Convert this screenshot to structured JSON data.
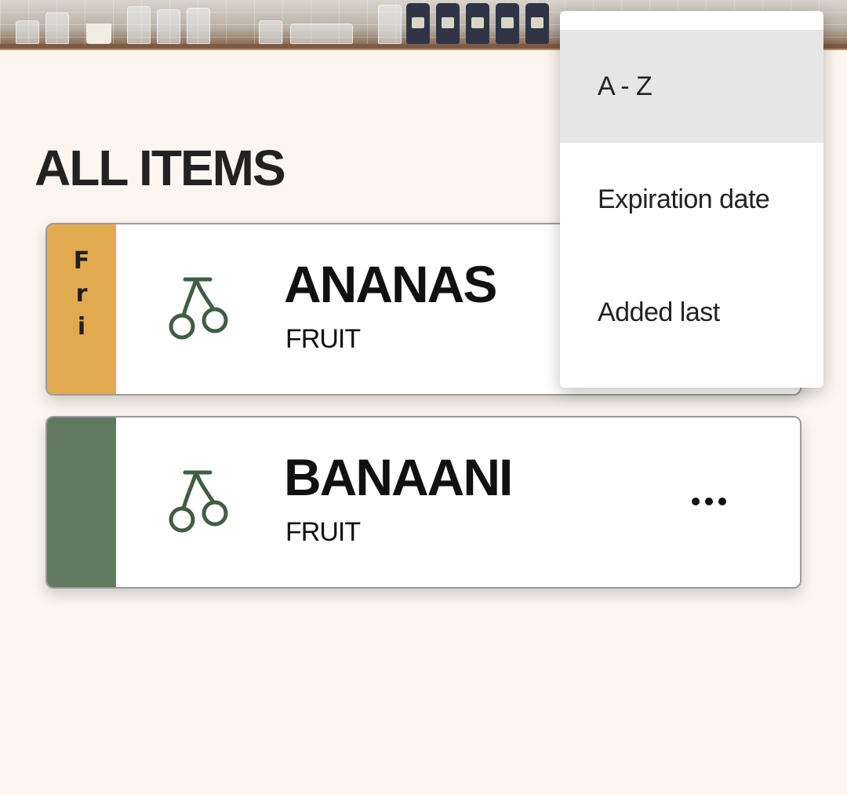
{
  "page": {
    "title": "ALL ITEMS"
  },
  "items": [
    {
      "name": "ANANAS",
      "category": "FRUIT",
      "icon": "cherry-icon",
      "strip_color": "#e2aa4f",
      "strip_letters": [
        "F",
        "r",
        "i"
      ]
    },
    {
      "name": "BANAANI",
      "category": "FRUIT",
      "icon": "cherry-icon",
      "strip_color": "#5f7a5f",
      "strip_letters": []
    }
  ],
  "sort_menu": {
    "options": [
      "A - Z",
      "Expiration date",
      "Added last"
    ],
    "selected": "A - Z"
  },
  "colors": {
    "background": "#fdf6f0",
    "icon_green": "#3f5e44",
    "menu_highlight": "#e6e6e6"
  }
}
